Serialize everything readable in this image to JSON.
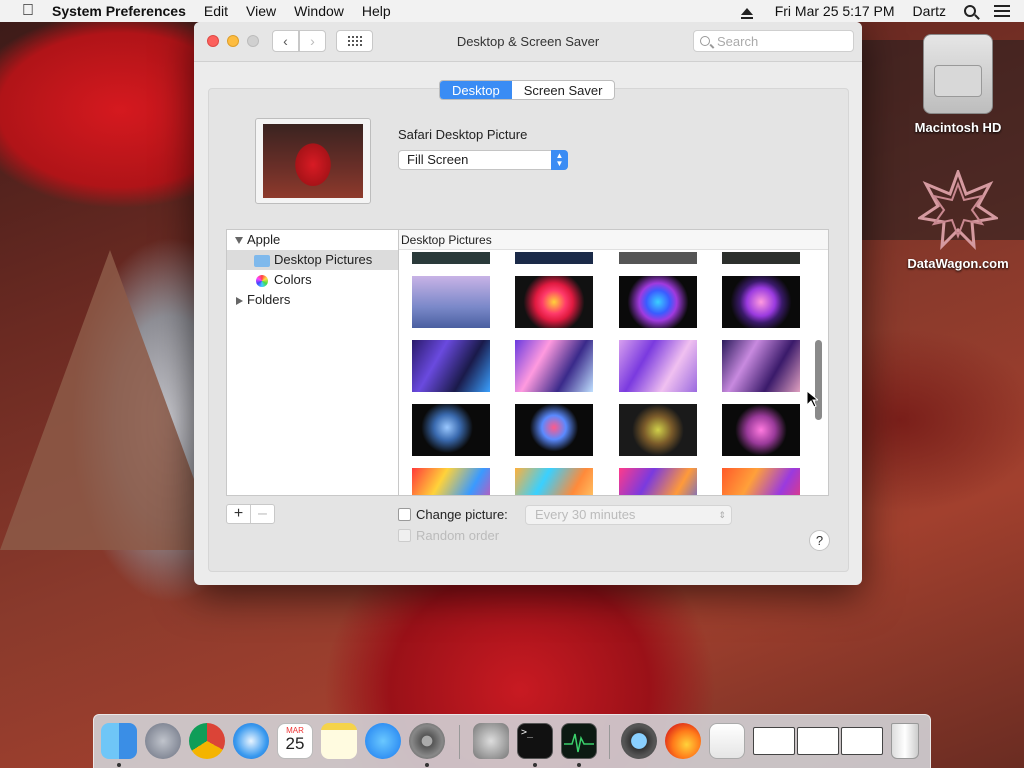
{
  "menubar": {
    "app_name": "System Preferences",
    "items": [
      "Edit",
      "View",
      "Window",
      "Help"
    ],
    "clock": "Fri Mar 25  5:17 PM",
    "user": "Dartz"
  },
  "desktop_icons": [
    {
      "label": "Macintosh HD",
      "icon": "hard-drive-icon"
    },
    {
      "label": "DataWagon.com",
      "icon": "star-logo-icon"
    }
  ],
  "window": {
    "title": "Desktop & Screen Saver",
    "search_placeholder": "Search",
    "tabs": [
      {
        "label": "Desktop",
        "active": true
      },
      {
        "label": "Screen Saver",
        "active": false
      }
    ],
    "picture_title": "Safari Desktop Picture",
    "fill_mode": "Fill Screen",
    "sources": {
      "apple": "Apple",
      "desktop_pictures": "Desktop Pictures",
      "colors": "Colors",
      "folders": "Folders"
    },
    "gallery_header": "Desktop Pictures",
    "change_picture_label": "Change picture:",
    "change_interval": "Every 30 minutes",
    "random_order_label": "Random order",
    "help": "?"
  },
  "dock": {
    "apps": [
      "finder-icon",
      "launchpad-icon",
      "chrome-icon",
      "safari-icon",
      "calendar-icon",
      "notes-icon",
      "app-store-icon",
      "system-preferences-icon",
      "automator-icon",
      "terminal-icon",
      "activity-monitor-icon",
      "spyglass-icon",
      "firefox-icon",
      "preview-icon",
      "window-1-thumb",
      "window-2-thumb",
      "window-3-thumb",
      "trash-icon"
    ],
    "calendar_month": "MAR",
    "calendar_day": "25"
  }
}
